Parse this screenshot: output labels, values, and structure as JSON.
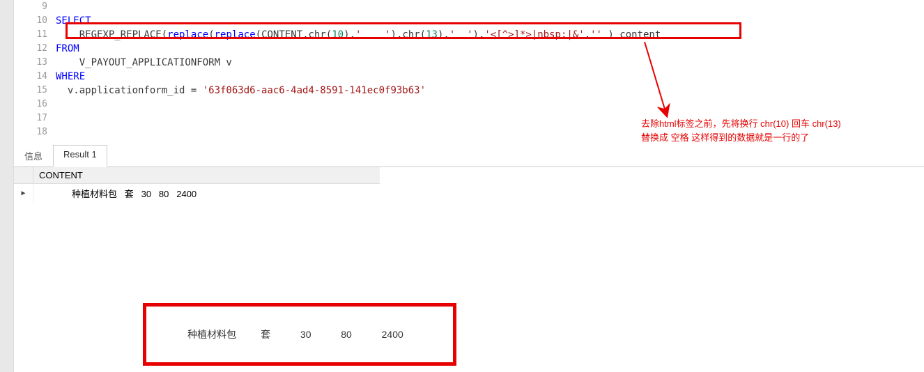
{
  "gutter": [
    "9",
    "10",
    "11",
    "12",
    "13",
    "14",
    "15",
    "16",
    "17",
    "18"
  ],
  "code": {
    "l10_select": "SELECT",
    "l11_fn1": "REGEXP_REPLACE",
    "l11_op1": "(",
    "l11_fn2": "replace",
    "l11_op2": "(",
    "l11_fn3": "replace",
    "l11_op3": "(CONTENT,chr(",
    "l11_n1": "10",
    "l11_op4": "),",
    "l11_s1": "'    '",
    "l11_op5": "),chr(",
    "l11_n2": "13",
    "l11_op6": "),",
    "l11_s2": "'  '",
    "l11_op7": "),",
    "l11_s3": "'<[^>]*>|nbsp;|&'",
    "l11_op8": ",",
    "l11_s4": "''",
    "l11_op9": " ) content",
    "l12_from": "FROM",
    "l13_tbl": "    V_PAYOUT_APPLICATIONFORM v",
    "l14_where": "WHERE",
    "l15_cond1": "  v.applicationform_id = ",
    "l15_str": "'63f063d6-aac6-4ad4-8591-141ec0f93b63'"
  },
  "tabs": {
    "t1": "信息",
    "t2": "Result 1"
  },
  "results": {
    "header": "CONTENT",
    "row1_indent": "             ",
    "row1": "种植材料包   套   30   80   2400"
  },
  "annotation": {
    "line1": "去除html标签之前，先将换行 chr(10)     回车 chr(13)",
    "line2": "替换成 空格    这样得到的数据就是一行的了"
  },
  "bottom_text": "种植材料包         套           30           80           2400"
}
